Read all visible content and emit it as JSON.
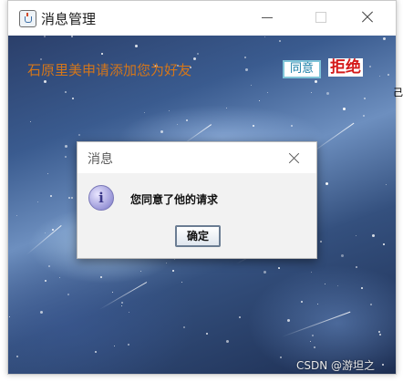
{
  "window": {
    "title": "消息管理"
  },
  "main": {
    "request_text": "石原里美申请添加您为好友",
    "agree_label": "同意",
    "reject_label": "拒绝",
    "edge_fragment": "己"
  },
  "dialog": {
    "title": "消息",
    "icon": "info-icon",
    "message": "您同意了他的请求",
    "ok_label": "确定"
  },
  "watermark": "CSDN @游坦之",
  "colors": {
    "request_text": "#d4761a",
    "agree_text": "#1b7fa8",
    "reject_text": "#d51a1a"
  }
}
